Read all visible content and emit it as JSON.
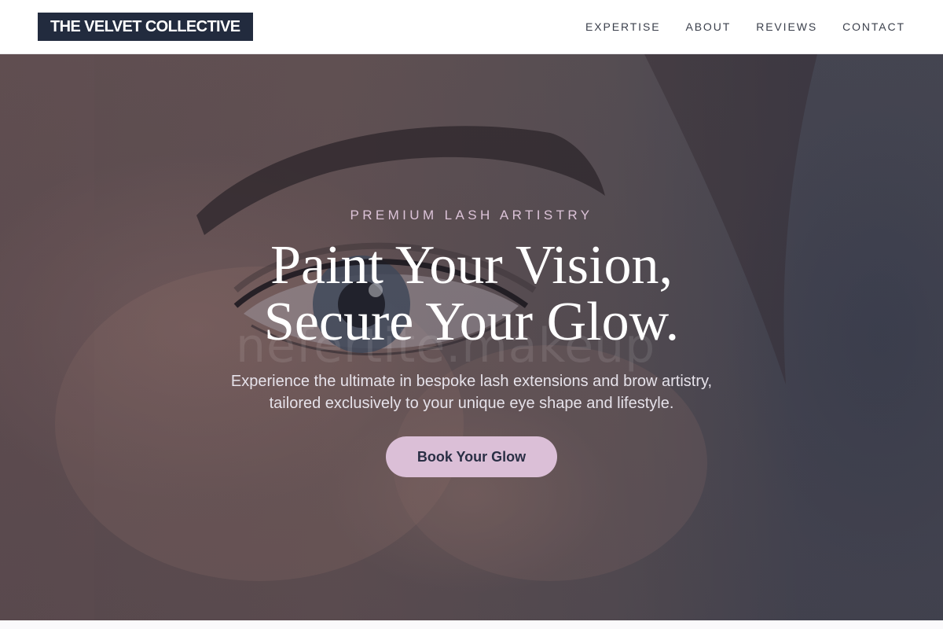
{
  "brand": {
    "name": "THE VELVET COLLECTIVE"
  },
  "nav": {
    "items": [
      {
        "label": "EXPERTISE"
      },
      {
        "label": "ABOUT"
      },
      {
        "label": "REVIEWS"
      },
      {
        "label": "CONTACT"
      }
    ]
  },
  "hero": {
    "eyebrow": "PREMIUM LASH ARTISTRY",
    "headline_line1": "Paint Your Vision,",
    "headline_line2": "Secure Your Glow.",
    "subtext_line1": "Experience the ultimate in bespoke lash extensions and brow artistry,",
    "subtext_line2": "tailored exclusively to your unique eye shape and lifestyle.",
    "cta_label": "Book Your Glow",
    "background_watermark": "nefertite.makeup"
  },
  "colors": {
    "logo_bg": "#222b3e",
    "accent": "#dbbfd7",
    "eyebrow": "#dcc3d8",
    "nav_text": "#3a3f4b"
  }
}
